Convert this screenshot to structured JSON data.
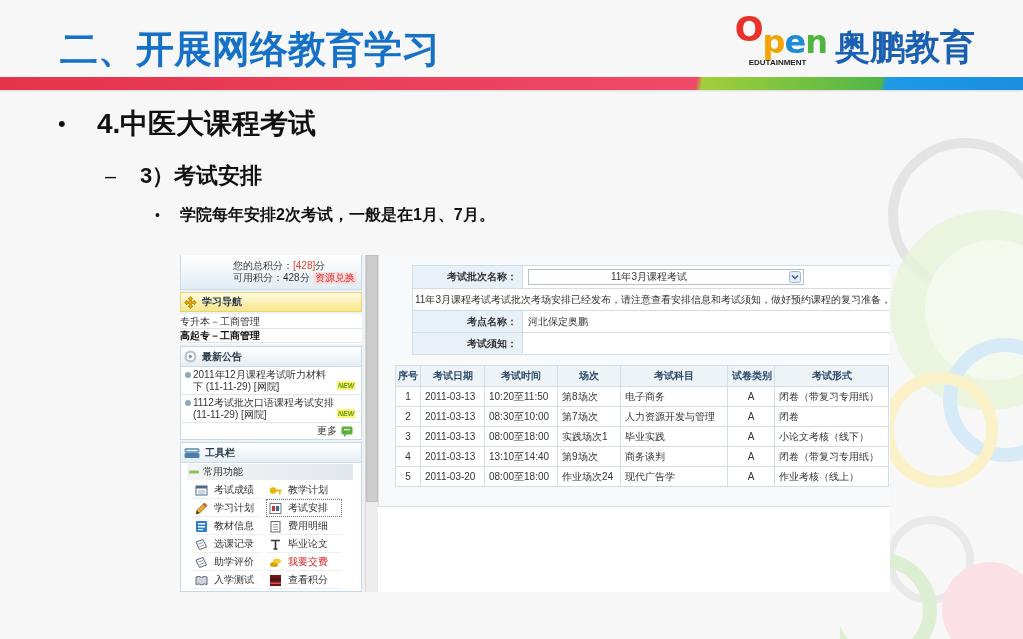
{
  "header": {
    "title": "二、开展网络教育学习",
    "logo": {
      "wordmark": "Open",
      "tagline": "EDUTAINMENT",
      "name": "奥鹏教育"
    }
  },
  "outline": [
    {
      "marker": "•",
      "text": "4.中医大课程考试",
      "children": [
        {
          "marker": "–",
          "text": "3）考试安排",
          "children": [
            {
              "marker": "•",
              "text": "学院每年安排2次考试，一般是在1月、7月。"
            }
          ]
        }
      ]
    }
  ],
  "screenshot": {
    "sidebar": {
      "points": {
        "total_label": "您的总积分：",
        "total_value": "[428]",
        "total_unit": "分",
        "available": "可用积分：428分",
        "redeem": "资源兑换"
      },
      "nav": {
        "title": "学习导航",
        "items": [
          {
            "label": "专升本－工商管理",
            "selected": false
          },
          {
            "label": "高起专－工商管理",
            "selected": true
          }
        ]
      },
      "notices": {
        "title": "最新公告",
        "items": [
          {
            "text": "2011年12月课程考试听力材料下 (11-11-29) [网院]",
            "badge": "NEW"
          },
          {
            "text": "1112考试批次口语课程考试安排 (11-11-29) [网院]",
            "badge": "NEW"
          }
        ],
        "more": "更多"
      },
      "toolbar": {
        "title": "工具栏",
        "group": "常用功能",
        "items": [
          {
            "label": "考试成绩",
            "selected": false,
            "highlight": false
          },
          {
            "label": "教学计划",
            "selected": false,
            "highlight": false
          },
          {
            "label": "学习计划",
            "selected": false,
            "highlight": false
          },
          {
            "label": "考试安排",
            "selected": true,
            "highlight": false
          },
          {
            "label": "教材信息",
            "selected": false,
            "highlight": false
          },
          {
            "label": "费用明细",
            "selected": false,
            "highlight": false
          },
          {
            "label": "选课记录",
            "selected": false,
            "highlight": false
          },
          {
            "label": "毕业论文",
            "selected": false,
            "highlight": false
          },
          {
            "label": "助学评价",
            "selected": false,
            "highlight": false
          },
          {
            "label": "我要交费",
            "selected": false,
            "highlight": true
          },
          {
            "label": "入学测试",
            "selected": false,
            "highlight": false
          },
          {
            "label": "查看积分",
            "selected": false,
            "highlight": false
          }
        ]
      }
    },
    "form": {
      "rows": [
        {
          "kind": "select",
          "label": "考试批次名称：",
          "value": "11年3月课程考试"
        },
        {
          "kind": "message",
          "text": "11年3月课程考试考试批次考场安排已经发布，请注意查看安排信息和考试须知，做好预约课程的复习准备，"
        },
        {
          "kind": "field",
          "label": "考点名称：",
          "value": "河北保定奥鹏"
        },
        {
          "kind": "field",
          "label": "考试须知："
        }
      ]
    },
    "exam_table": {
      "columns": [
        "序号",
        "考试日期",
        "考试时间",
        "场次",
        "考试科目",
        "试卷类别",
        "考试形式"
      ],
      "rows": [
        [
          "1",
          "2011-03-13",
          "10:20至11:50",
          "第8场次",
          "电子商务",
          "A",
          "闭卷（带复习专用纸）"
        ],
        [
          "2",
          "2011-03-13",
          "08:30至10:00",
          "第7场次",
          "人力资源开发与管理",
          "A",
          "闭卷"
        ],
        [
          "3",
          "2011-03-13",
          "08:00至18:00",
          "实践场次1",
          "毕业实践",
          "A",
          "小论文考核（线下）"
        ],
        [
          "4",
          "2011-03-13",
          "13:10至14:40",
          "第9场次",
          "商务谈判",
          "A",
          "闭卷（带复习专用纸）"
        ],
        [
          "5",
          "2011-03-20",
          "08:00至18:00",
          "作业场次24",
          "现代广告学",
          "A",
          "作业考核（线上）"
        ]
      ]
    }
  }
}
